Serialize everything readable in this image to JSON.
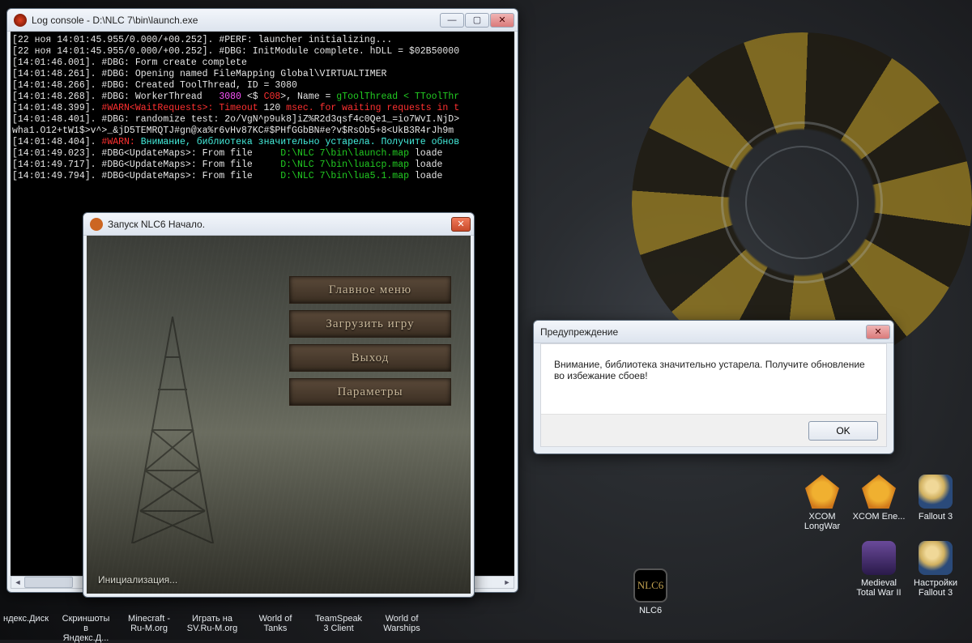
{
  "console_window": {
    "title": "Log console - D:\\NLC 7\\bin\\launch.exe",
    "lines": [
      [
        {
          "c": "c-w",
          "t": "[22 ноя 14:01:45.955/0.000/+00.252]. #PERF: launcher initializing..."
        }
      ],
      [
        {
          "c": "c-w",
          "t": "[22 ноя 14:01:45.955/0.000/+00.252]. #DBG: InitModule complete. hDLL = $02B50000"
        }
      ],
      [
        {
          "c": "c-w",
          "t": "[14:01:46.001]. #DBG: Form create complete"
        }
      ],
      [
        {
          "c": "c-w",
          "t": "[14:01:48.261]. #DBG: Opening named FileMapping Global\\VIRTUALTIMER"
        }
      ],
      [
        {
          "c": "c-w",
          "t": "[14:01:48.266]. #DBG: Created ToolThread, ID = 3080"
        }
      ],
      [
        {
          "c": "c-w",
          "t": "[14:01:48.268]. #DBG: WorkerThread   "
        },
        {
          "c": "c-m",
          "t": "3080"
        },
        {
          "c": "c-w",
          "t": " <$ "
        },
        {
          "c": "c-r",
          "t": "C08"
        },
        {
          "c": "c-w",
          "t": ">, Name = "
        },
        {
          "c": "c-g",
          "t": "gToolThread < TToolThr"
        }
      ],
      [
        {
          "c": "c-w",
          "t": "[14:01:48.399]. "
        },
        {
          "c": "c-r",
          "t": "#WARN<WaitRequests>: Timeout"
        },
        {
          "c": "c-w",
          "t": " 120 "
        },
        {
          "c": "c-r",
          "t": "msec. for waiting requests in t"
        }
      ],
      [
        {
          "c": "c-w",
          "t": "[14:01:48.401]. #DBG: randomize test: 2o/VgN^p9uk8]iZ%R2d3qsf4c0Qe1_=io7WvI.NjD>"
        }
      ],
      [
        {
          "c": "c-w",
          "t": "wha1.O12+tW1$>v^>_&jD5TEMRQTJ#gn@xa%r6vHv87KC#$PHfGGbBN#e?v$RsOb5+8<UkB3R4rJh9m"
        }
      ],
      [
        {
          "c": "c-w",
          "t": "[14:01:48.404]. "
        },
        {
          "c": "c-r",
          "t": "#WARN:"
        },
        {
          "c": "c-c",
          "t": " Внимание, библиотека значительно устарела. Получите обнов"
        }
      ],
      [
        {
          "c": "c-w",
          "t": "[14:01:49.023]. #DBG<UpdateMaps>: From file     "
        },
        {
          "c": "c-g",
          "t": "D:\\NLC 7\\bin\\launch.map"
        },
        {
          "c": "c-w",
          "t": " loade"
        }
      ],
      [
        {
          "c": "c-w",
          "t": "[14:01:49.717]. #DBG<UpdateMaps>: From file     "
        },
        {
          "c": "c-g",
          "t": "D:\\NLC 7\\bin\\luaicp.map"
        },
        {
          "c": "c-w",
          "t": " loade"
        }
      ],
      [
        {
          "c": "c-w",
          "t": "[14:01:49.794]. #DBG<UpdateMaps>: From file     "
        },
        {
          "c": "c-g",
          "t": "D:\\NLC 7\\bin\\lua5.1.map"
        },
        {
          "c": "c-w",
          "t": " loade"
        }
      ]
    ]
  },
  "launcher_window": {
    "title": "Запуск NLC6 Начало.",
    "menu": [
      "Главное меню",
      "Загрузить игру",
      "Выход",
      "Параметры"
    ],
    "status": "Инициализация..."
  },
  "message_box": {
    "title": "Предупреждение",
    "text": "Внимание, библиотека значительно устарела. Получите обновление во избежание сбоев!",
    "ok": "OK"
  },
  "desktop_icons": [
    {
      "label": "Fallout 3",
      "kind": "ic-fallout"
    },
    {
      "label": "XCOM Ene...",
      "kind": "ic-xcom"
    },
    {
      "label": "XCOM LongWar",
      "kind": "ic-xcom"
    },
    {
      "label": "Настройки Fallout 3",
      "kind": "ic-fallout"
    },
    {
      "label": "Medieval Total War II",
      "kind": "ic-med"
    }
  ],
  "nlc_icon": {
    "label": "NLC6",
    "text": "NLC6"
  },
  "taskbar": [
    "ндекс.Диск",
    "Скриншоты в Яндекс.Д...",
    "Minecraft - Ru-M.org",
    "Играть на SV.Ru-M.org",
    "World of Tanks",
    "TeamSpeak 3 Client",
    "World of Warships"
  ],
  "win_controls": {
    "min": "—",
    "max": "▢",
    "close": "✕"
  }
}
